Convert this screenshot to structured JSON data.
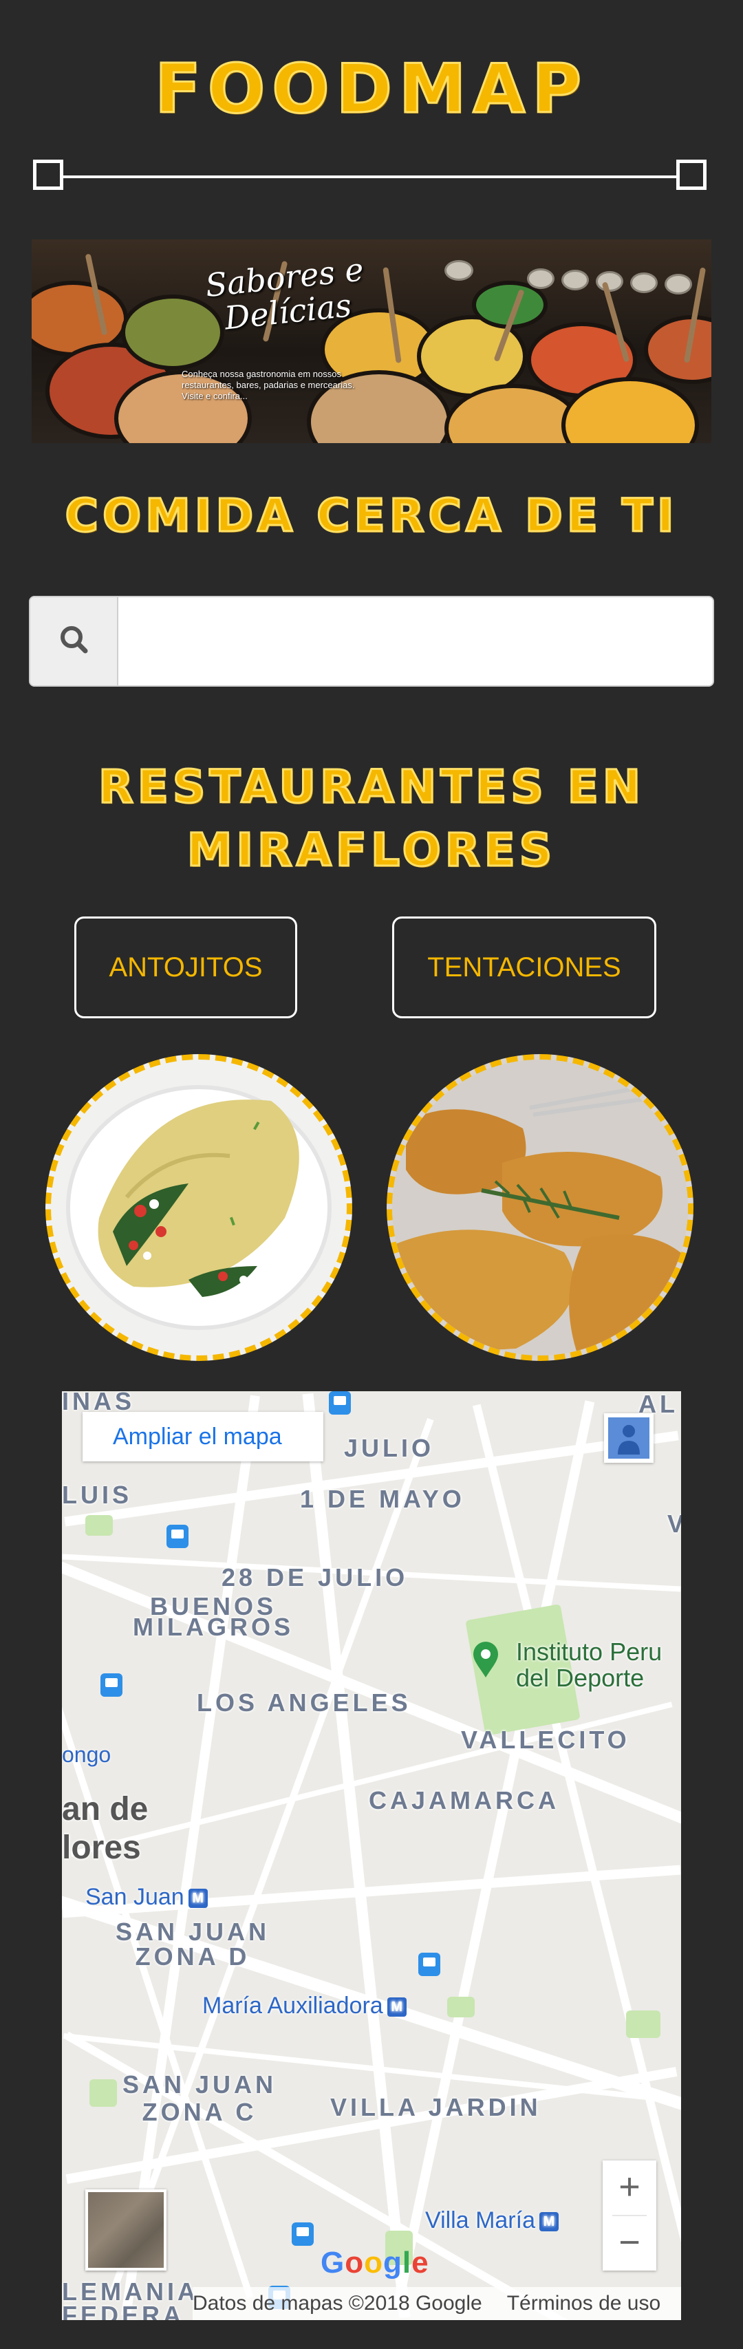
{
  "header": {
    "logo": "FOODMAP"
  },
  "banner": {
    "title": "Sabores e Delícias",
    "subtitle": "Conheça nossa gastronomia em nossos restaurantes, bares, padarias e mercearias. Visite e confira..."
  },
  "section_near": {
    "title": "COMIDA CERCA DE TI"
  },
  "search": {
    "icon": "search-icon",
    "placeholder": "",
    "value": ""
  },
  "section_restaurants": {
    "title": "RESTAURANTES EN MIRAFLORES"
  },
  "categories": [
    {
      "label": "ANTOJITOS"
    },
    {
      "label": "TENTACIONES"
    }
  ],
  "map": {
    "expand_label": "Ampliar el mapa",
    "area_labels": {
      "inas": "INAS",
      "al": "AL",
      "julio": "JULIO",
      "luis": "LUIS",
      "primero_mayo": "1 DE MAYO",
      "v": "V",
      "veintiocho_julio": "28 DE JULIO",
      "buenos_milagros": "BUENOS MILAGROS",
      "los_angeles": "LOS ANGELES",
      "vallecito": "VALLECITO",
      "cajamarca": "CAJAMARCA",
      "san_juan_d": "SAN JUAN ZONA D",
      "san_juan_c": "SAN JUAN ZONA C",
      "villa_jardin": "VILLA JARDIN",
      "alemania": "LEMANIA",
      "federa": "FEDERA"
    },
    "place_labels": {
      "instituto": "Instituto Peru del Deporte",
      "ongo": "ongo",
      "an_de_lores": "an de lores"
    },
    "metro": {
      "san_juan": "San Juan",
      "maria_aux": "María Auxiliadora",
      "villa_maria": "Villa María"
    },
    "google": "Google",
    "attribution": "Datos de mapas ©2018 Google",
    "terms": "Términos de uso",
    "zoom_in": "+",
    "zoom_out": "−"
  },
  "colors": {
    "background": "#292929",
    "accent": "#f5b700",
    "outline": "#ffffff"
  }
}
